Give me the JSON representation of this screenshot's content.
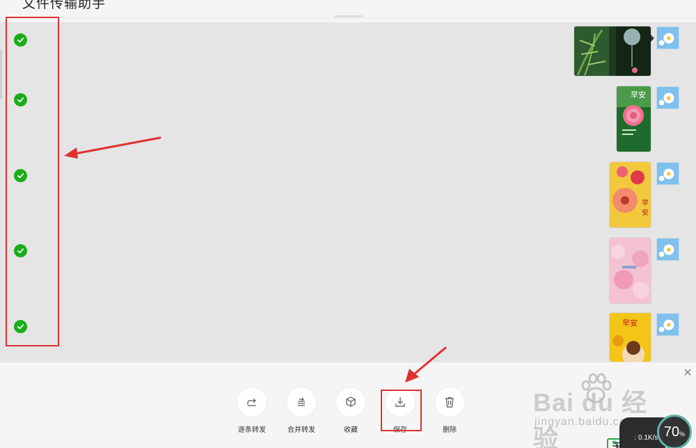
{
  "window": {
    "title": "文件传输助手"
  },
  "messages": [
    {
      "id": 1,
      "selected": true,
      "image": "bamboo-wind-chime-photo"
    },
    {
      "id": 2,
      "selected": true,
      "image": "pink-carnation-zaoan-card"
    },
    {
      "id": 3,
      "selected": true,
      "image": "gerbera-zaoan-card"
    },
    {
      "id": 4,
      "selected": true,
      "image": "cherry-blossom-card"
    },
    {
      "id": 5,
      "selected": true,
      "image": "sunflower-zaoan-card"
    }
  ],
  "card_texts": {
    "zaoan": "早安",
    "zaoan_v1": "早",
    "zaoan_v2": "安"
  },
  "actions": [
    {
      "key": "forward_each",
      "label": "逐条转发",
      "icon": "forward-icon"
    },
    {
      "key": "forward_merged",
      "label": "合并转发",
      "icon": "merge-forward-icon"
    },
    {
      "key": "favorite",
      "label": "收藏",
      "icon": "cube-icon"
    },
    {
      "key": "save",
      "label": "保存",
      "icon": "download-icon"
    },
    {
      "key": "delete",
      "label": "删除",
      "icon": "trash-icon"
    }
  ],
  "close_glyph": "✕",
  "watermark": {
    "logo": "Bai  du 经验",
    "url": "jingyan.baidu.com"
  },
  "network_widget": {
    "speed": "0.1",
    "unit": "K/s",
    "arrow": "↓",
    "percent": "70",
    "percent_sign": "%"
  },
  "taskbar": {
    "app_letter": "S",
    "partial_text": "天"
  },
  "colors": {
    "check_green": "#1aad19",
    "highlight_red": "#e03030",
    "chat_bg": "#e5e5e5"
  }
}
